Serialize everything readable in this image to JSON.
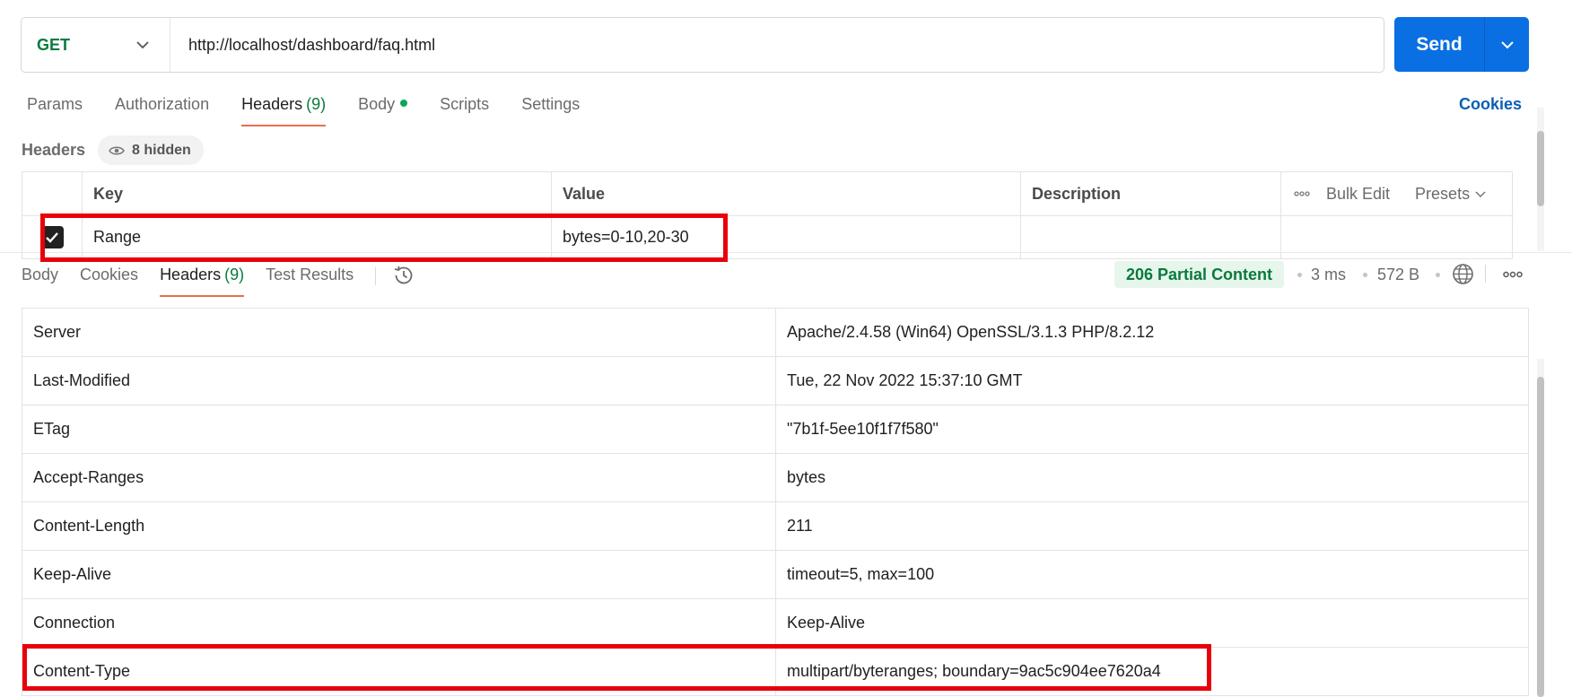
{
  "request": {
    "method": "GET",
    "url": "http://localhost/dashboard/faq.html",
    "send_label": "Send"
  },
  "request_tabs": {
    "params": "Params",
    "authorization": "Authorization",
    "headers": "Headers",
    "headers_count": "(9)",
    "body": "Body",
    "scripts": "Scripts",
    "settings": "Settings",
    "cookies": "Cookies"
  },
  "request_headers": {
    "label": "Headers",
    "hidden_label": "8 hidden",
    "columns": {
      "key": "Key",
      "value": "Value",
      "description": "Description"
    },
    "bulk_edit": "Bulk Edit",
    "presets": "Presets",
    "rows": [
      {
        "checked": true,
        "key": "Range",
        "value": "bytes=0-10,20-30",
        "description": ""
      }
    ]
  },
  "response_tabs": {
    "body": "Body",
    "cookies": "Cookies",
    "headers": "Headers",
    "headers_count": "(9)",
    "test_results": "Test Results"
  },
  "response_meta": {
    "status": "206 Partial Content",
    "time": "3 ms",
    "size": "572 B"
  },
  "response_headers": [
    {
      "key": "Server",
      "value": "Apache/2.4.58 (Win64) OpenSSL/3.1.3 PHP/8.2.12"
    },
    {
      "key": "Last-Modified",
      "value": "Tue, 22 Nov 2022 15:37:10 GMT"
    },
    {
      "key": "ETag",
      "value": "\"7b1f-5ee10f1f7f580\""
    },
    {
      "key": "Accept-Ranges",
      "value": "bytes"
    },
    {
      "key": "Content-Length",
      "value": "211"
    },
    {
      "key": "Keep-Alive",
      "value": "timeout=5, max=100"
    },
    {
      "key": "Connection",
      "value": "Keep-Alive"
    },
    {
      "key": "Content-Type",
      "value": "multipart/byteranges; boundary=9ac5c904ee7620a4"
    }
  ],
  "colors": {
    "send_button": "#0a6fe2",
    "method_green": "#0a7a3d",
    "active_tab_underline": "#e86f4f",
    "highlight_red": "#e8000b",
    "status_badge_bg": "#e7f6ec"
  }
}
